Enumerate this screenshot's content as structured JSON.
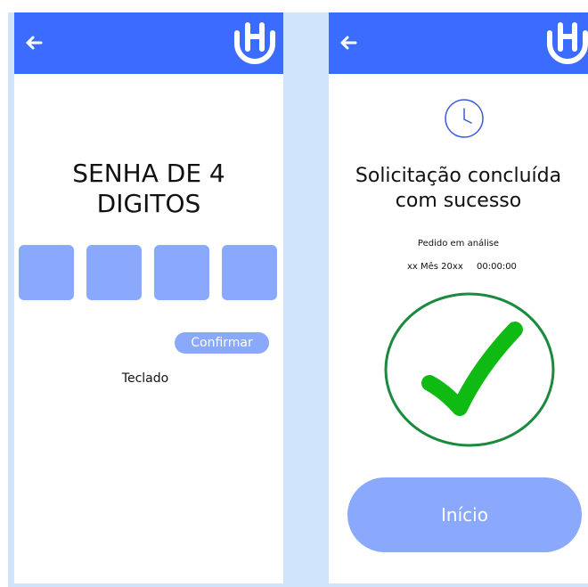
{
  "colors": {
    "topbar": "#3b6cff",
    "accent_light": "#8aa9fc",
    "background_strip": "#d0e4fb",
    "success_green": "#0fba12",
    "circle_green": "#1c8a3e"
  },
  "icons": {
    "back": "left-arrow",
    "logo": "h-smile-logo",
    "clock": "clock",
    "success": "check-mark-in-circle"
  },
  "screen_pin": {
    "title": "SENHA DE 4\nDIGITOS",
    "pin_boxes": [
      "",
      "",
      "",
      ""
    ],
    "confirm_label": "Confirmar",
    "keyboard_label": "Teclado"
  },
  "screen_success": {
    "title": "Solicitação concluída\ncom sucesso",
    "status": "Pedido em análise",
    "date": "xx Mês 20xx",
    "time": "00:00:00",
    "home_label": "Início"
  }
}
